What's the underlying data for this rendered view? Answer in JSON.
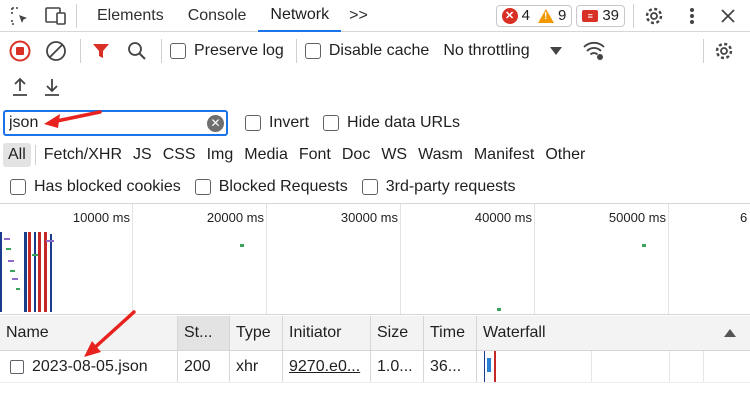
{
  "tabs": {
    "elements": "Elements",
    "console": "Console",
    "network": "Network",
    "more": ">>"
  },
  "badges": {
    "errors": "4",
    "warnings": "9",
    "issues": "39"
  },
  "toolbar": {
    "preserve_log": "Preserve log",
    "disable_cache": "Disable cache",
    "throttling": "No throttling"
  },
  "filter": {
    "value": "json",
    "invert": "Invert",
    "hide_data_urls": "Hide data URLs"
  },
  "types": [
    "All",
    "Fetch/XHR",
    "JS",
    "CSS",
    "Img",
    "Media",
    "Font",
    "Doc",
    "WS",
    "Wasm",
    "Manifest",
    "Other"
  ],
  "blocked": {
    "cookies": "Has blocked cookies",
    "requests": "Blocked Requests",
    "third_party": "3rd-party requests"
  },
  "overview": {
    "ticks": [
      "10000 ms",
      "20000 ms",
      "30000 ms",
      "40000 ms",
      "50000 ms",
      "6"
    ]
  },
  "table": {
    "headers": [
      "Name",
      "St...",
      "Type",
      "Initiator",
      "Size",
      "Time",
      "Waterfall"
    ],
    "rows": [
      {
        "name": "2023-08-05.json",
        "status": "200",
        "type": "xhr",
        "initiator": "9270.e0...",
        "size": "1.0...",
        "time": "36..."
      }
    ]
  },
  "colors": {
    "accent": "#1a73e8",
    "record": "#d93025",
    "annotation_arrow": "#e8231f"
  }
}
